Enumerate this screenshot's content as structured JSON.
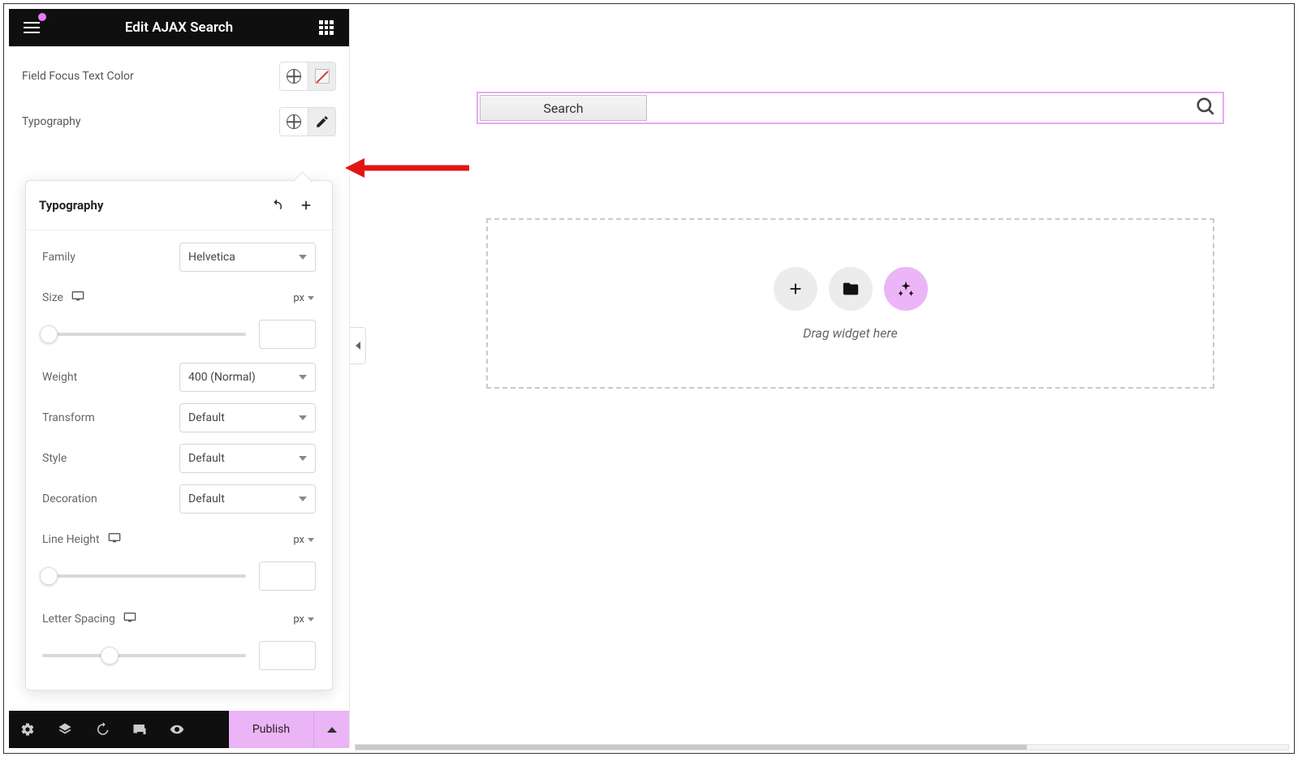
{
  "header": {
    "title": "Edit AJAX Search"
  },
  "controls": {
    "field_focus_label": "Field Focus Text Color",
    "typography_label": "Typography"
  },
  "popover": {
    "title": "Typography",
    "family_label": "Family",
    "family_value": "Helvetica",
    "size_label": "Size",
    "size_unit": "px",
    "weight_label": "Weight",
    "weight_value": "400 (Normal)",
    "transform_label": "Transform",
    "transform_value": "Default",
    "style_label": "Style",
    "style_value": "Default",
    "decoration_label": "Decoration",
    "decoration_value": "Default",
    "line_height_label": "Line Height",
    "line_height_unit": "px",
    "letter_spacing_label": "Letter Spacing",
    "letter_spacing_unit": "px"
  },
  "footer": {
    "publish_label": "Publish"
  },
  "preview": {
    "search_button_label": "Search",
    "dropzone_label": "Drag widget here"
  }
}
